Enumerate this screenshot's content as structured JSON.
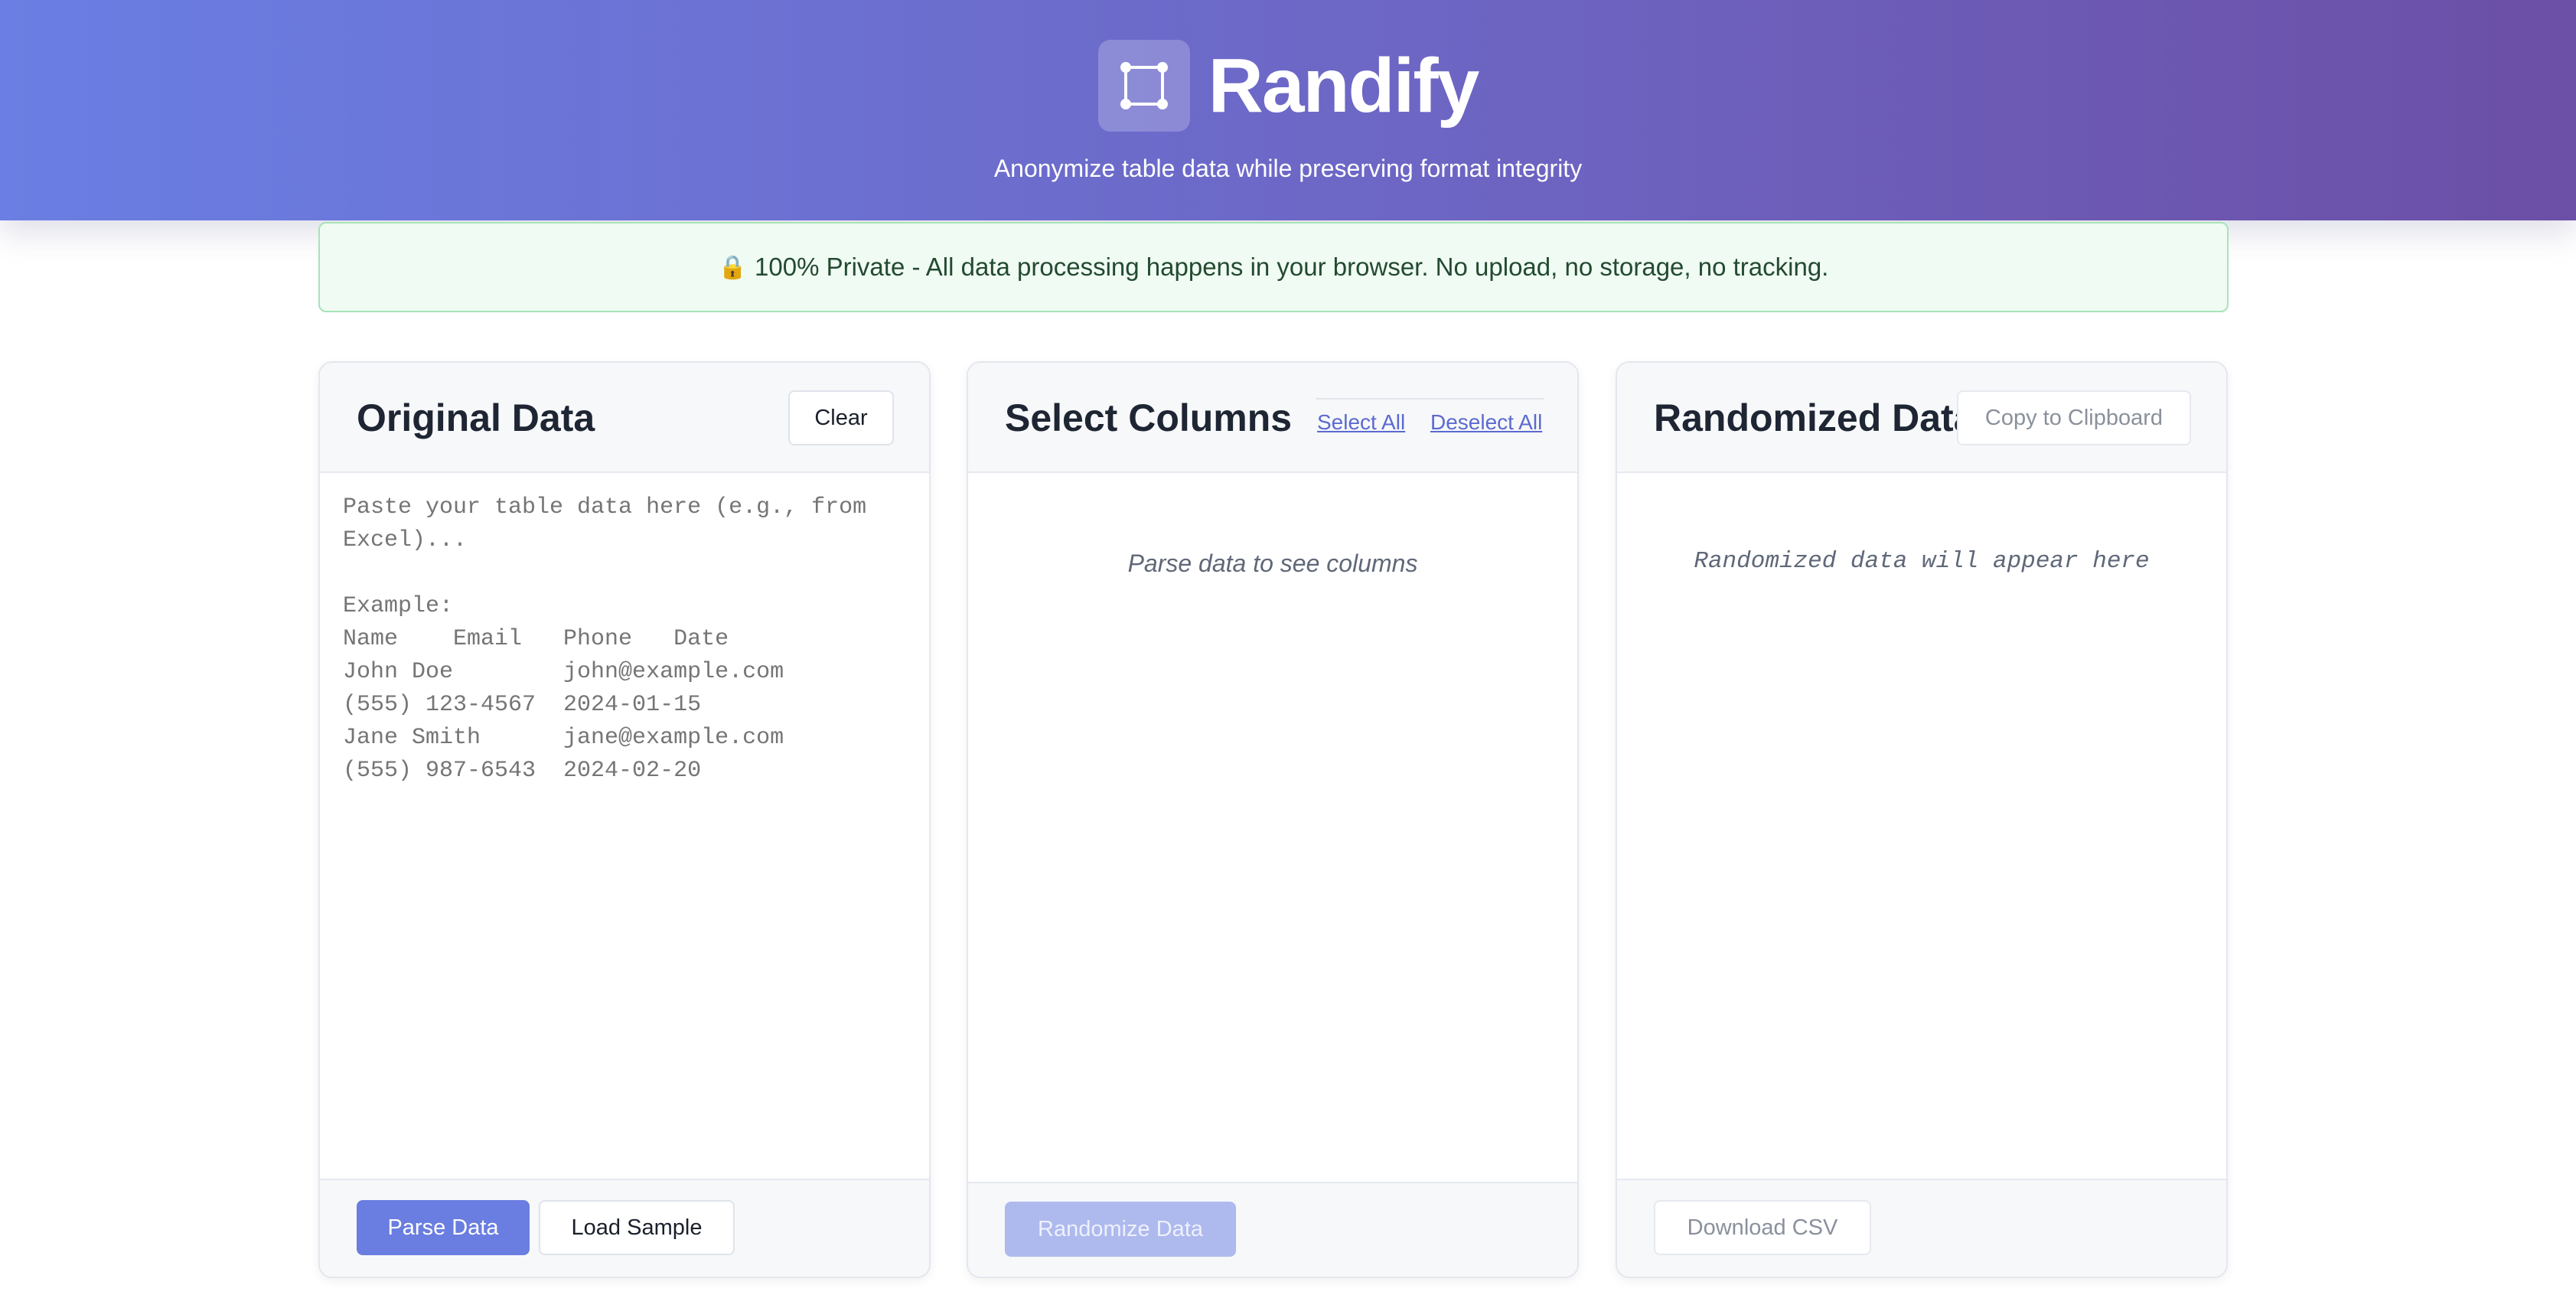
{
  "app": {
    "title": "Randify",
    "tagline": "Anonymize table data while preserving format integrity"
  },
  "privacy_notice": {
    "icon": "lock-icon",
    "text": "100% Private - All data processing happens in your browser. No upload, no storage, no tracking."
  },
  "original_panel": {
    "title": "Original Data",
    "clear_label": "Clear",
    "placeholder": "Paste your table data here (e.g., from Excel)...\n\nExample:\nName\tEmail\tPhone\tDate\nJohn Doe\tjohn@example.com\t(555) 123-4567\t2024-01-15\nJane Smith\tjane@example.com\t(555) 987-6543\t2024-02-20",
    "value": "",
    "parse_label": "Parse Data",
    "load_sample_label": "Load Sample"
  },
  "columns_panel": {
    "title": "Select Columns",
    "select_all_label": "Select All",
    "deselect_all_label": "Deselect All",
    "empty_message": "Parse data to see columns",
    "randomize_label": "Randomize Data"
  },
  "randomized_panel": {
    "title": "Randomized Data",
    "copy_label": "Copy to Clipboard",
    "empty_message": "Randomized data will appear here",
    "download_label": "Download CSV"
  },
  "colors": {
    "header_gradient_start": "#6a7ee3",
    "header_gradient_end": "#6c4fa6",
    "primary": "#6a7de0",
    "privacy_bg": "#f0fbf3",
    "privacy_border": "#a7e3b7"
  }
}
